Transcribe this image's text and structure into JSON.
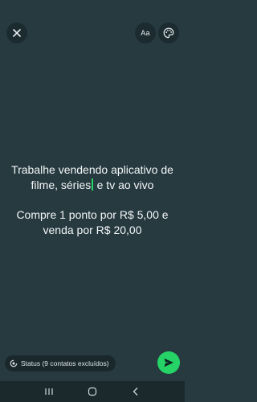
{
  "colors": {
    "background": "#263a40",
    "accent": "#25d366",
    "button_bg": "#1c2b30",
    "navbar_bg": "#1b292d"
  },
  "header": {
    "close_icon": "close-icon",
    "font_button_label": "Aa",
    "palette_icon": "palette-icon"
  },
  "message": {
    "line1_before_cursor": "Trabalhe vendendo aplicativo de filme, séries",
    "line1_after_cursor": " e tv ao vivo",
    "line2": "Compre 1 ponto por R$ 5,00 e venda por R$ 20,00"
  },
  "footer": {
    "status_icon": "status-privacy-icon",
    "status_label": "Status (9 contatos excluídos)",
    "send_icon": "send-icon"
  },
  "navbar": {
    "recents_icon": "recents-icon",
    "home_icon": "home-icon",
    "back_icon": "back-icon"
  }
}
